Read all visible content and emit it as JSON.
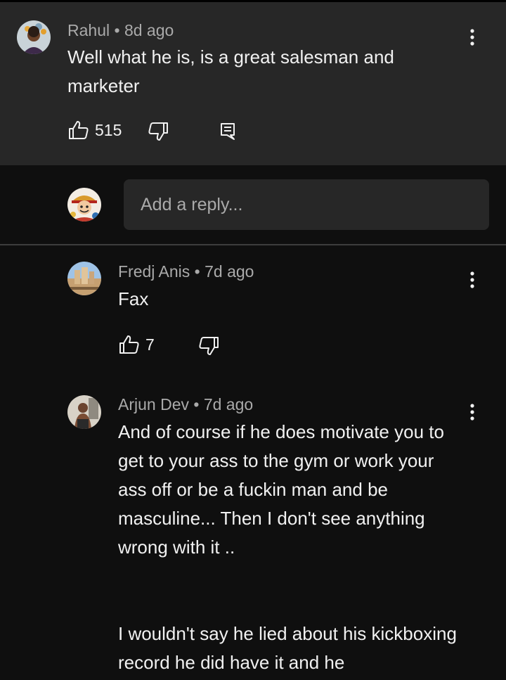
{
  "comment": {
    "author": "Rahul",
    "age": "8d ago",
    "text": "Well what he is, is a great salesman and marketer",
    "likes": "515",
    "icons": {
      "like": "thumbs-up-icon",
      "dislike": "thumbs-down-icon",
      "reply": "reply-icon",
      "more": "more-vert-icon"
    }
  },
  "reply_input": {
    "placeholder": "Add a reply..."
  },
  "replies": [
    {
      "author": "Fredj Anis",
      "age": "7d ago",
      "text": "Fax",
      "likes": "7"
    },
    {
      "author": "Arjun Dev",
      "age": "7d ago",
      "paragraph1": "And of course if he does motivate you to get to your ass to the gym or work your ass off or be a fuckin man and be masculine... Then I don't see anything wrong with it ..",
      "paragraph2": "I wouldn't say he lied about his kickboxing record he did have it and he"
    }
  ],
  "colors": {
    "background": "#0f0f0f",
    "highlight": "#272727",
    "meta": "#aaaaaa",
    "text": "#f1f1f1"
  }
}
